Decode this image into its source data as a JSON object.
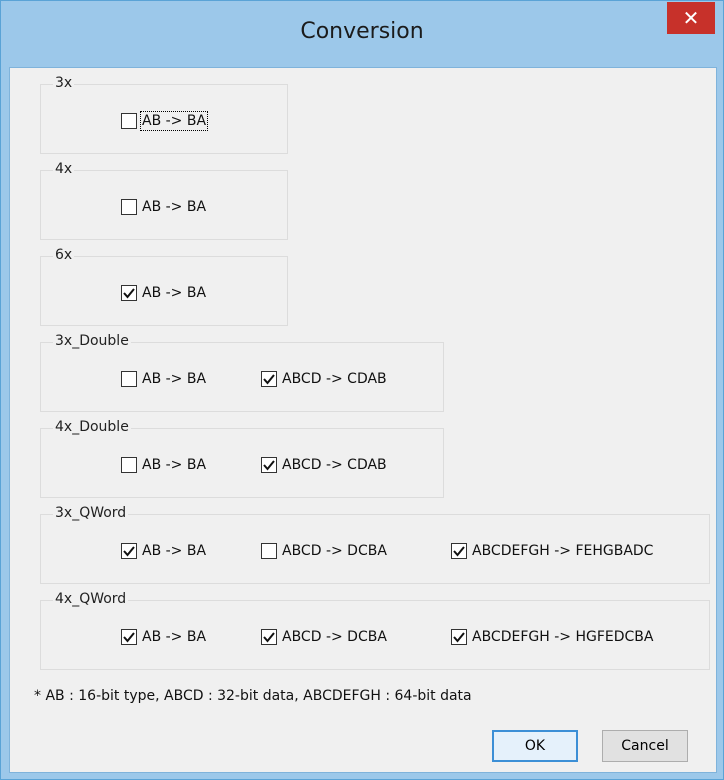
{
  "window": {
    "title": "Conversion",
    "close_glyph": "✕"
  },
  "groups": [
    {
      "label": "3x",
      "options": [
        {
          "label": "AB -> BA",
          "checked": false
        }
      ]
    },
    {
      "label": "4x",
      "options": [
        {
          "label": "AB -> BA",
          "checked": false
        }
      ]
    },
    {
      "label": "6x",
      "options": [
        {
          "label": "AB -> BA",
          "checked": true
        }
      ]
    },
    {
      "label": "3x_Double",
      "options": [
        {
          "label": "AB -> BA",
          "checked": false
        },
        {
          "label": "ABCD -> CDAB",
          "checked": true
        }
      ]
    },
    {
      "label": "4x_Double",
      "options": [
        {
          "label": "AB -> BA",
          "checked": false
        },
        {
          "label": "ABCD -> CDAB",
          "checked": true
        }
      ]
    },
    {
      "label": "3x_QWord",
      "options": [
        {
          "label": "AB -> BA",
          "checked": true
        },
        {
          "label": "ABCD -> DCBA",
          "checked": false
        },
        {
          "label": "ABCDEFGH -> FEHGBADC",
          "checked": true
        }
      ]
    },
    {
      "label": "4x_QWord",
      "options": [
        {
          "label": "AB -> BA",
          "checked": true
        },
        {
          "label": "ABCD -> DCBA",
          "checked": true
        },
        {
          "label": "ABCDEFGH -> HGFEDCBA",
          "checked": true
        }
      ]
    }
  ],
  "note": "* AB : 16-bit type, ABCD : 32-bit data, ABCDEFGH : 64-bit data",
  "buttons": {
    "ok": "OK",
    "cancel": "Cancel"
  },
  "colors": {
    "title_bar": "#9cc8ea",
    "close": "#c7312a",
    "client": "#f0f0f0",
    "default_button_border": "#3c8fd6"
  }
}
